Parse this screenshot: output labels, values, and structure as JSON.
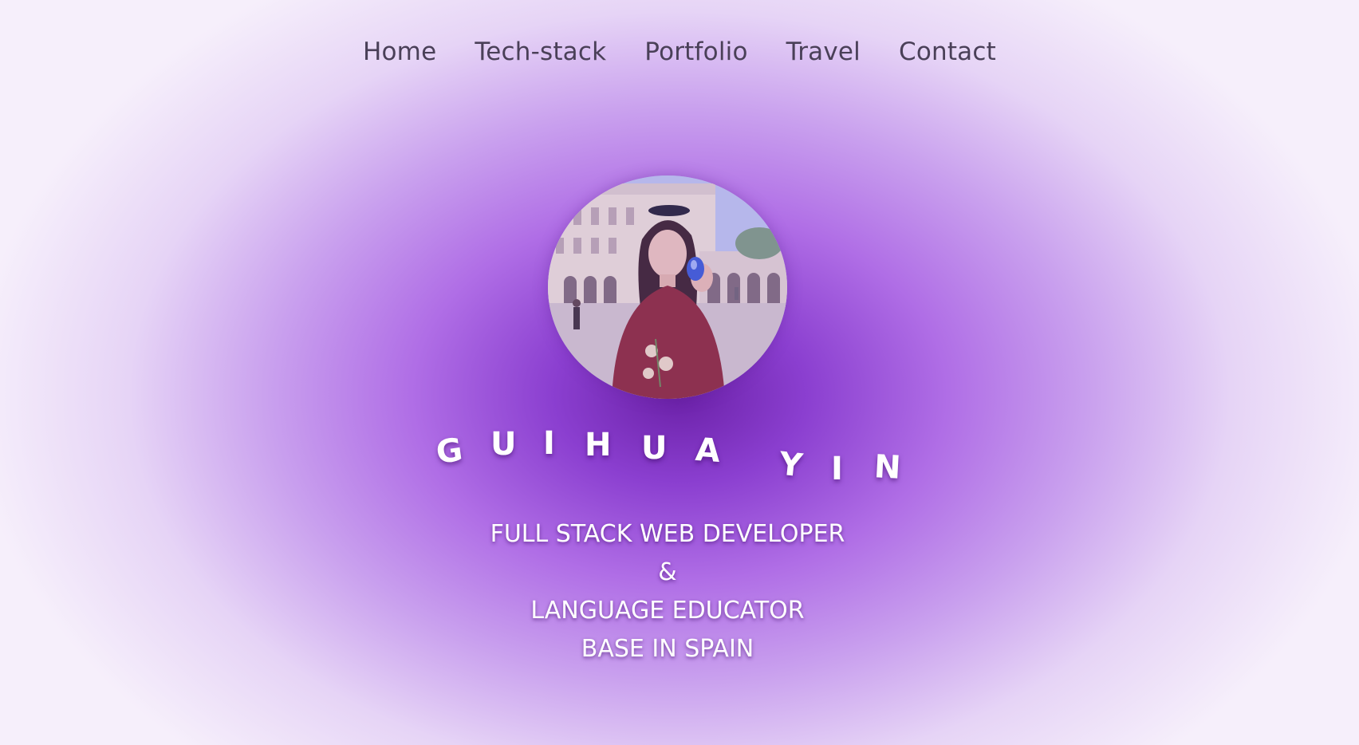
{
  "nav": {
    "items": [
      {
        "label": "Home"
      },
      {
        "label": "Tech-stack"
      },
      {
        "label": "Portfolio"
      },
      {
        "label": "Travel"
      },
      {
        "label": "Contact"
      }
    ]
  },
  "hero": {
    "avatar_alt": "profile photo",
    "name_letters": [
      "G",
      "U",
      "I",
      "H",
      "U",
      "A",
      "Y",
      "I",
      "N"
    ],
    "tagline": {
      "line1": "FULL STACK WEB DEVELOPER",
      "line2": "&",
      "line3": "LANGUAGE EDUCATOR",
      "line4": "BASE IN SPAIN"
    }
  },
  "colors": {
    "background_center": "#6b21a8",
    "background_edge": "#f6effb",
    "nav_text": "#4a4058",
    "hero_text": "#ffffff"
  }
}
